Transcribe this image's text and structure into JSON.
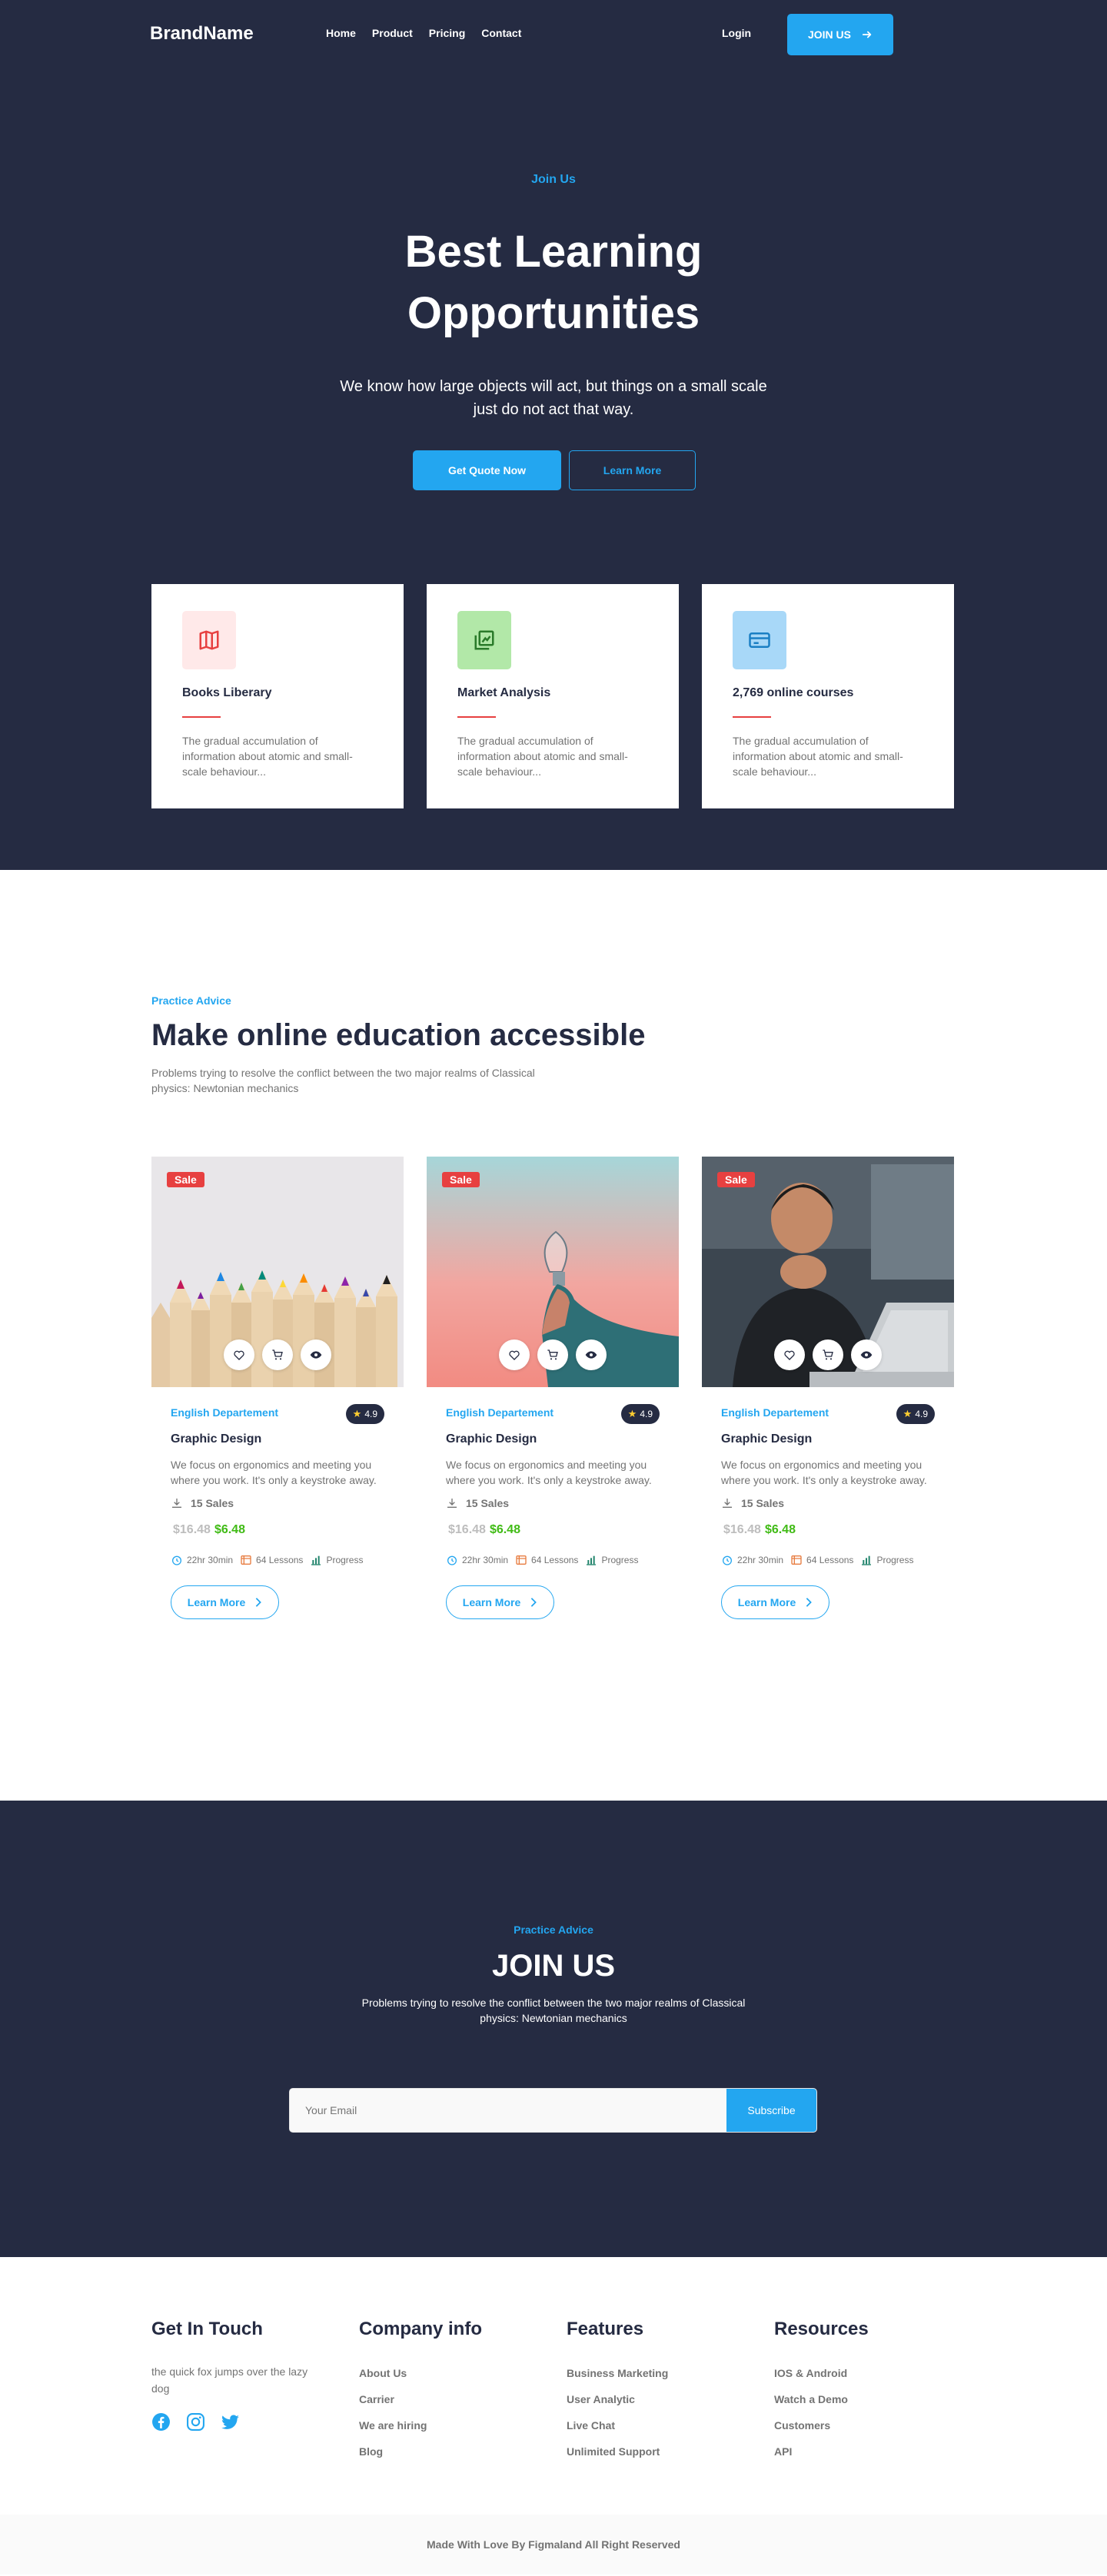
{
  "colors": {
    "dark": "#252B42",
    "accent": "#23A6F0",
    "danger": "#E74040",
    "success": "#40BB15",
    "muted": "#737373"
  },
  "nav": {
    "brand": "BrandName",
    "links": [
      "Home",
      "Product",
      "Pricing",
      "Contact"
    ],
    "login": "Login",
    "join": "JOIN US"
  },
  "hero": {
    "kicker": "Join Us",
    "title": "Best Learning Opportunities",
    "subtitle": "We know how large objects will act, but things on a small scale just do not act that way.",
    "cta_primary": "Get Quote Now",
    "cta_secondary": "Learn More"
  },
  "features": [
    {
      "icon": "book-icon",
      "title": "Books Liberary",
      "desc": "The gradual accumulation of information about atomic and small-scale behaviour..."
    },
    {
      "icon": "chart-icon",
      "title": "Market Analysis",
      "desc": "The gradual accumulation of information about atomic and small-scale behaviour..."
    },
    {
      "icon": "card-icon",
      "title": "2,769 online courses",
      "desc": "The gradual accumulation of information about atomic and small-scale behaviour..."
    }
  ],
  "courses_section": {
    "kicker": "Practice Advice",
    "title": "Make online education accessible",
    "subtitle": "Problems trying to resolve the conflict between the two major realms of Classical physics: Newtonian mechanics"
  },
  "courses": [
    {
      "badge": "Sale",
      "department": "English Departement",
      "rating": "4.9",
      "title": "Graphic Design",
      "desc": "We focus on ergonomics and meeting you where you work. It's only a keystroke away.",
      "sales": "15 Sales",
      "old_price": "$16.48",
      "new_price": "$6.48",
      "duration": "22hr 30min",
      "lessons": "64 Lessons",
      "progress": "Progress",
      "cta": "Learn More"
    },
    {
      "badge": "Sale",
      "department": "English Departement",
      "rating": "4.9",
      "title": "Graphic Design",
      "desc": "We focus on ergonomics and meeting you where you work. It's only a keystroke away.",
      "sales": "15 Sales",
      "old_price": "$16.48",
      "new_price": "$6.48",
      "duration": "22hr 30min",
      "lessons": "64 Lessons",
      "progress": "Progress",
      "cta": "Learn More"
    },
    {
      "badge": "Sale",
      "department": "English Departement",
      "rating": "4.9",
      "title": "Graphic Design",
      "desc": "We focus on ergonomics and meeting you where you work. It's only a keystroke away.",
      "sales": "15 Sales",
      "old_price": "$16.48",
      "new_price": "$6.48",
      "duration": "22hr 30min",
      "lessons": "64 Lessons",
      "progress": "Progress",
      "cta": "Learn More"
    }
  ],
  "join_section": {
    "kicker": "Practice Advice",
    "title": "JOIN US",
    "subtitle": "Problems trying to resolve the conflict between the two major realms of Classical physics: Newtonian mechanics",
    "email_placeholder": "Your Email",
    "submit": "Subscribe"
  },
  "footer": {
    "contact_title": "Get In Touch",
    "tagline": "the quick fox jumps over the lazy dog",
    "columns": [
      {
        "title": "Company info",
        "links": [
          "About Us",
          "Carrier",
          "We are hiring",
          "Blog"
        ]
      },
      {
        "title": "Features",
        "links": [
          "Business Marketing",
          "User Analytic",
          "Live Chat",
          "Unlimited Support"
        ]
      },
      {
        "title": "Resources",
        "links": [
          "IOS & Android",
          "Watch a Demo",
          "Customers",
          "API"
        ]
      }
    ],
    "copyright": "Made With Love By Figmaland All Right Reserved"
  }
}
